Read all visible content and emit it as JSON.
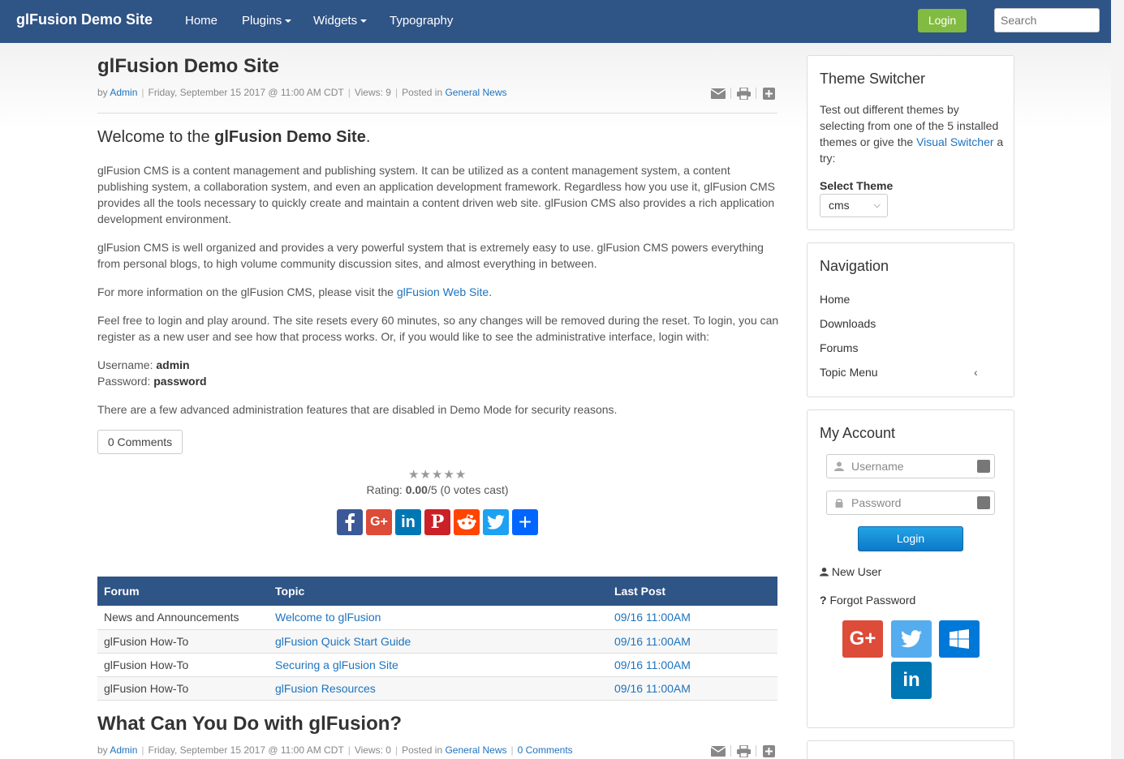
{
  "navbar": {
    "brand": "glFusion Demo Site",
    "items": [
      {
        "label": "Home"
      },
      {
        "label": "Plugins"
      },
      {
        "label": "Widgets"
      },
      {
        "label": "Typography"
      }
    ],
    "login_label": "Login",
    "search_placeholder": "Search",
    "bg_color": "#2f5486"
  },
  "article1": {
    "title": "glFusion Demo Site",
    "meta": {
      "by": "by",
      "author": "Admin",
      "date": "Friday, September 15 2017 @ 11:00 AM CDT",
      "views": "Views: 9",
      "posted_in": "Posted in",
      "category": "General News"
    },
    "welcome_prefix": "Welcome to the ",
    "welcome_bold": "glFusion Demo Site",
    "welcome_suffix": ".",
    "p1": "glFusion CMS is a content management and publishing system. It can be utilized as a content management system, a content publishing system, a collaboration system, and even an application development framework. Regardless how you use it, glFusion CMS provides all the tools necessary to quickly create and maintain a content driven web site. glFusion CMS also provides a rich application development environment.",
    "p2": "glFusion CMS is well organized and provides a very powerful system that is extremely easy to use. glFusion CMS powers everything from personal blogs, to high volume community discussion sites, and almost everything in between.",
    "p3_prefix": "For more information on the glFusion CMS, please visit the ",
    "p3_link": "glFusion Web Site",
    "p3_suffix": ".",
    "p4": "Feel free to login and play around. The site resets every 60 minutes, so any changes will be removed during the reset. To login, you can register as a new user and see how that process works. Or, if you would like to see the administrative interface, login with:",
    "username_label": "Username: ",
    "username_value": "admin",
    "password_label": "Password: ",
    "password_value": "password",
    "p5": "There are a few advanced administration features that are disabled in Demo Mode for security reasons.",
    "comments_button": "0 Comments",
    "rating": {
      "prefix": "Rating: ",
      "value": "0.00",
      "suffix": "/5 (0 votes cast)",
      "stars": 5
    }
  },
  "share": [
    {
      "icon": "facebook-icon",
      "glyph": "f",
      "color": "#3b5998"
    },
    {
      "icon": "google-plus-icon",
      "glyph": "G+",
      "color": "#dd4b39"
    },
    {
      "icon": "linkedin-icon",
      "glyph": "in",
      "color": "#0077b5"
    },
    {
      "icon": "pinterest-icon",
      "glyph": "P",
      "color": "#cb2027"
    },
    {
      "icon": "reddit-icon",
      "glyph": "☻",
      "color": "#ff4500"
    },
    {
      "icon": "twitter-icon",
      "glyph": "🐦",
      "color": "#1da1f2"
    },
    {
      "icon": "more-share-icon",
      "glyph": "+",
      "color": "#0166ff"
    }
  ],
  "forum": {
    "headers": [
      "Forum",
      "Topic",
      "Last Post"
    ],
    "rows": [
      {
        "forum": "News and Announcements",
        "topic": "Welcome to glFusion",
        "last": "09/16 11:00AM"
      },
      {
        "forum": "glFusion How-To",
        "topic": "glFusion Quick Start Guide",
        "last": "09/16 11:00AM"
      },
      {
        "forum": "glFusion How-To",
        "topic": "Securing a glFusion Site",
        "last": "09/16 11:00AM"
      },
      {
        "forum": "glFusion How-To",
        "topic": "glFusion Resources",
        "last": "09/16 11:00AM"
      }
    ]
  },
  "article2": {
    "title": "What Can You Do with glFusion?",
    "meta": {
      "by": "by",
      "author": "Admin",
      "date": "Friday, September 15 2017 @ 11:00 AM CDT",
      "views": "Views: 0",
      "posted_in": "Posted in",
      "category": "General News",
      "comments": "0 Comments"
    }
  },
  "sidebar": {
    "theme": {
      "title": "Theme Switcher",
      "text_prefix": "Test out different themes by selecting from one of the 5 installed themes or give the ",
      "text_link": "Visual Switcher",
      "text_suffix": " a try:",
      "select_label": "Select Theme",
      "selected": "cms"
    },
    "navigation": {
      "title": "Navigation",
      "items": [
        "Home",
        "Downloads",
        "Forums",
        "Topic Menu"
      ]
    },
    "account": {
      "title": "My Account",
      "username_placeholder": "Username",
      "password_placeholder": "Password",
      "login_label": "Login",
      "new_user": "New User",
      "forgot_password": "Forgot Password",
      "forgot_prefix": "?"
    },
    "sso": [
      {
        "icon": "google-plus-icon",
        "glyph": "G+",
        "color": "#dd4b39"
      },
      {
        "icon": "twitter-icon",
        "glyph": "🐦",
        "color": "#55acee"
      },
      {
        "icon": "windows-icon",
        "glyph": "⊞",
        "color": "#0078d7"
      },
      {
        "icon": "linkedin-icon",
        "glyph": "in",
        "color": "#0077b5"
      }
    ]
  }
}
